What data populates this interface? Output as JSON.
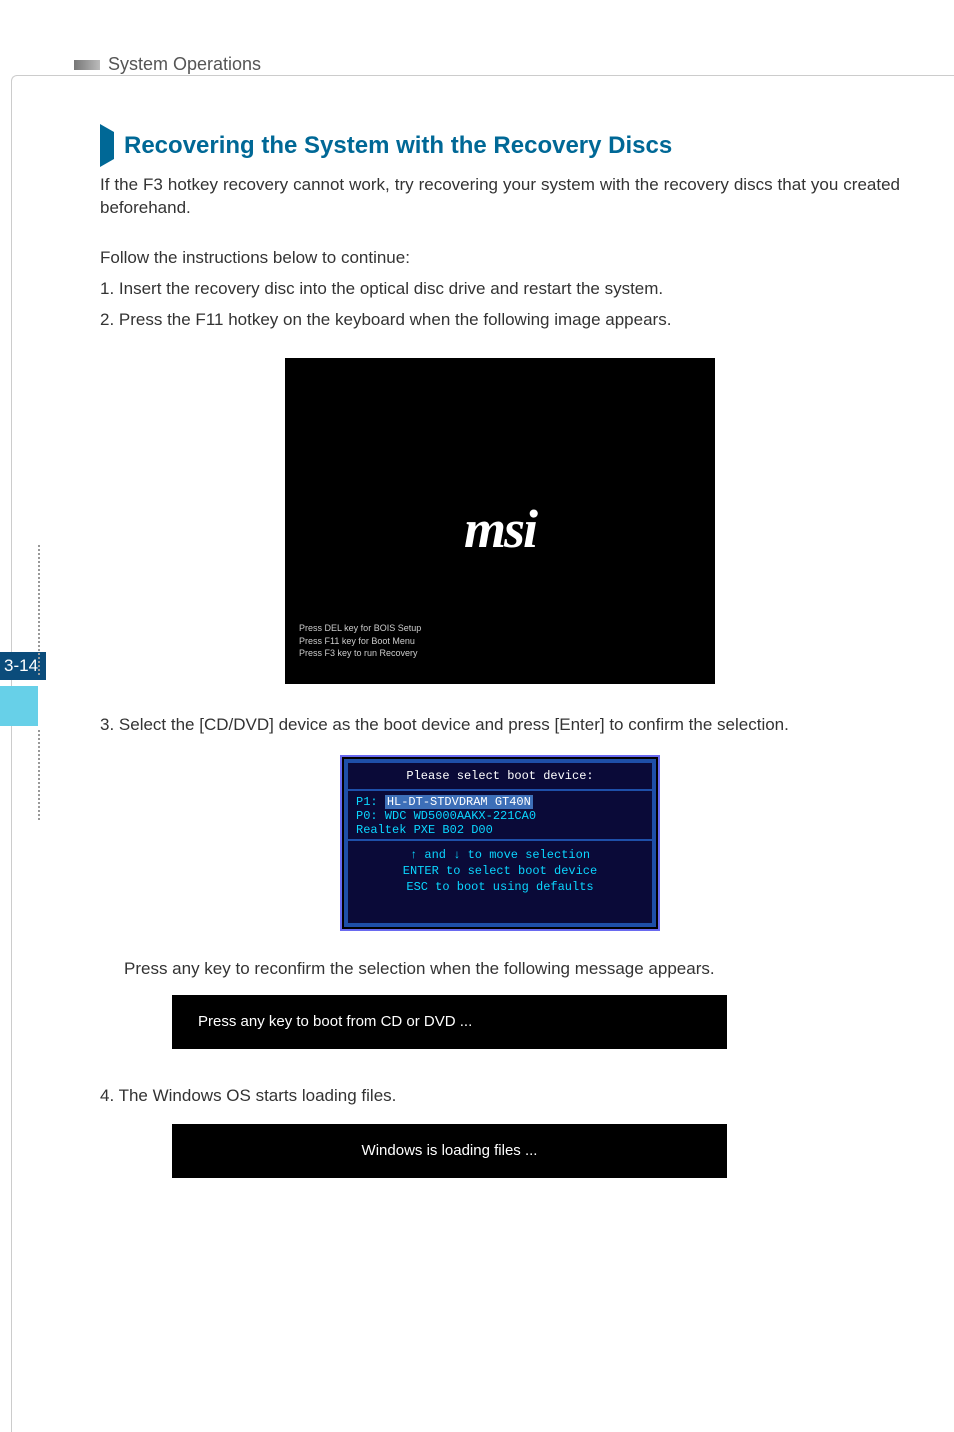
{
  "header": {
    "title": "System Operations"
  },
  "page_number": "3-14",
  "section": {
    "heading": "Recovering the System with the Recovery Discs",
    "intro": "If the F3 hotkey recovery cannot work, try recovering your system with the recovery discs that you created beforehand.",
    "follow": "Follow the instructions below to continue:",
    "step1": "1. Insert the recovery disc into the optical disc drive and restart the system.",
    "step2": "2. Press the F11 hotkey on the keyboard when the following image appears.",
    "step3": "3. Select the [CD/DVD] device as the boot device and press [Enter] to confirm the selection.",
    "substep3": "Press any key to reconfirm the selection when the following message appears.",
    "step4": "4. The Windows OS starts loading files."
  },
  "bios": {
    "logo": "msi",
    "hint1": "Press DEL key for BOIS Setup",
    "hint2": "Press F11  key for Boot Menu",
    "hint3": "Press F3   key to run Recovery"
  },
  "boot_menu": {
    "title": "Please select boot device:",
    "item1_label": "P1: ",
    "item1_value": "HL-DT-STDVDRAM GT40N",
    "item2": "P0: WDC WD5000AAKX-221CA0",
    "item3": "Realtek PXE B02 D00",
    "hint1": "↑ and ↓ to move selection",
    "hint2": "ENTER to select boot device",
    "hint3": "ESC to boot using defaults"
  },
  "press_key_bar": "Press any key to boot from CD or DVD ...",
  "loading_bar": "Windows is loading files ..."
}
